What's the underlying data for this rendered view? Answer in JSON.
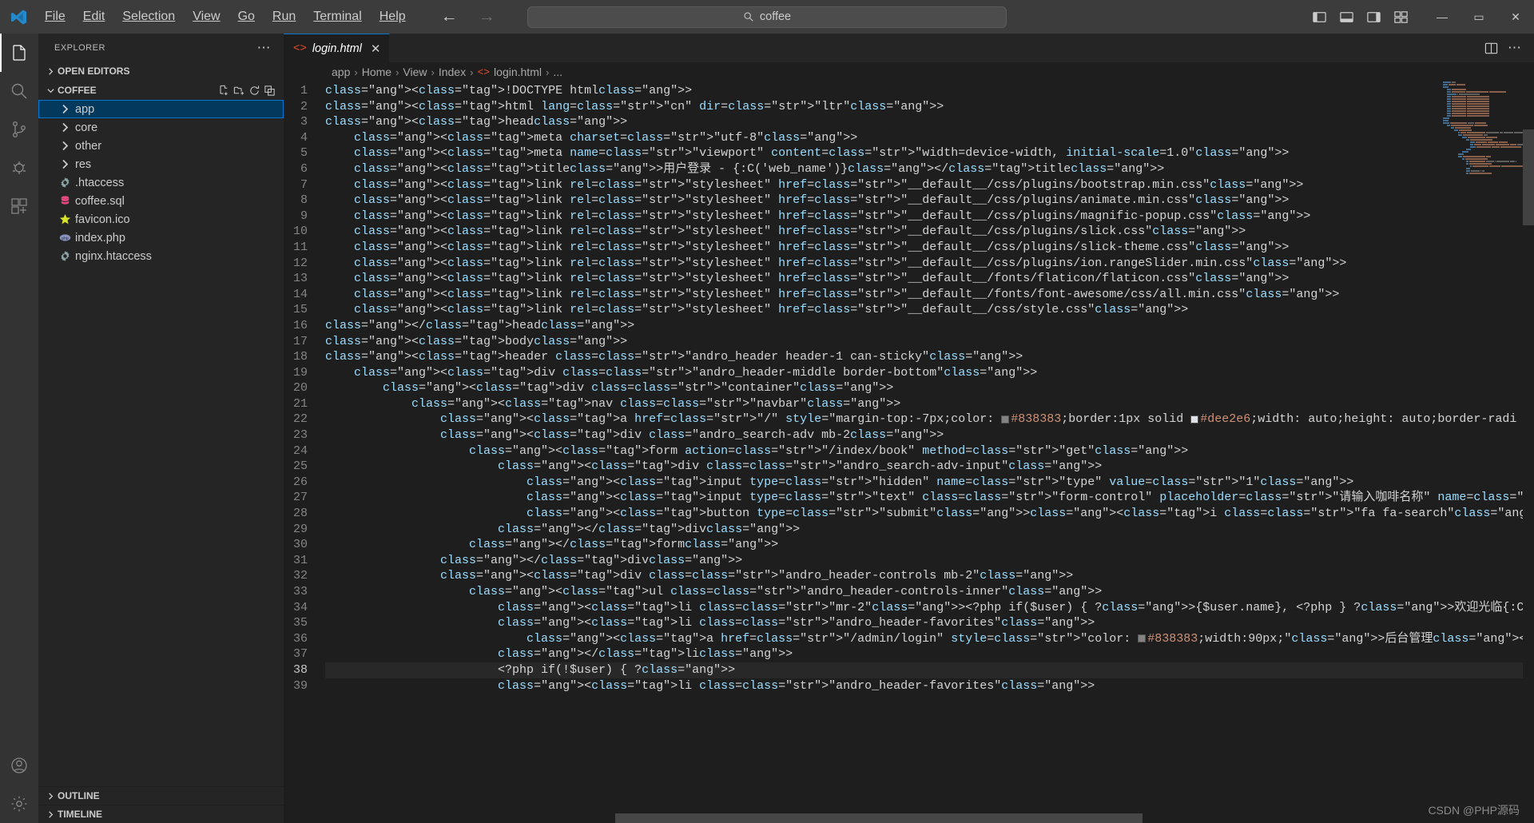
{
  "titlebar": {
    "logo_icon": "vscode-logo",
    "menus": [
      "File",
      "Edit",
      "Selection",
      "View",
      "Go",
      "Run",
      "Terminal",
      "Help"
    ],
    "back_icon": "arrow-left-icon",
    "forward_icon": "arrow-right-icon",
    "search": {
      "value": "coffee",
      "icon": "search-icon"
    },
    "layout_icons": [
      "panel-left-icon",
      "panel-bottom-icon",
      "panel-right-icon",
      "layout-grid-icon"
    ],
    "window_controls": {
      "minimize": "—",
      "maximize": "▭",
      "close": "✕"
    }
  },
  "activitybar": {
    "items": [
      {
        "name": "explorer",
        "icon": "files-icon",
        "active": true
      },
      {
        "name": "search",
        "icon": "search-icon",
        "active": false
      },
      {
        "name": "source-control",
        "icon": "source-control-icon",
        "active": false
      },
      {
        "name": "run-and-debug",
        "icon": "debug-icon",
        "active": false
      },
      {
        "name": "extensions",
        "icon": "extensions-icon",
        "active": false
      }
    ],
    "bottom": [
      {
        "name": "accounts",
        "icon": "account-icon"
      },
      {
        "name": "manage",
        "icon": "gear-icon"
      }
    ]
  },
  "sidebar": {
    "title": "EXPLORER",
    "more_actions": "⋯",
    "open_editors": {
      "label": "OPEN EDITORS",
      "expanded": false
    },
    "workspace": {
      "label": "COFFEE",
      "expanded": true,
      "actions": [
        "new-file-icon",
        "new-folder-icon",
        "refresh-icon",
        "collapse-all-icon"
      ]
    },
    "tree": [
      {
        "label": "app",
        "type": "folder",
        "selected": true,
        "icon": "chevron-right-icon"
      },
      {
        "label": "core",
        "type": "folder",
        "selected": false,
        "icon": "chevron-right-icon"
      },
      {
        "label": "other",
        "type": "folder",
        "selected": false,
        "icon": "chevron-right-icon"
      },
      {
        "label": "res",
        "type": "folder",
        "selected": false,
        "icon": "chevron-right-icon"
      },
      {
        "label": ".htaccess",
        "type": "file",
        "icon": "gear-file-icon"
      },
      {
        "label": "coffee.sql",
        "type": "file",
        "icon": "database-icon"
      },
      {
        "label": "favicon.ico",
        "type": "file",
        "icon": "star-icon"
      },
      {
        "label": "index.php",
        "type": "file",
        "icon": "php-icon"
      },
      {
        "label": "nginx.htaccess",
        "type": "file",
        "icon": "gear-file-icon"
      }
    ],
    "outline": "OUTLINE",
    "timeline": "TIMELINE"
  },
  "editor": {
    "tab": {
      "label": "login.html",
      "icon": "html-icon",
      "close": "✕",
      "dirty": false
    },
    "tabs_overflow": "⋯",
    "tab_actions": [
      "split-editor-icon",
      "more-actions-icon"
    ],
    "breadcrumb": [
      "app",
      "Home",
      "View",
      "Index",
      "login.html",
      "..."
    ],
    "breadcrumb_file_icon": "html-icon",
    "watermark": "CSDN @PHP源码",
    "colors": {
      "tag": "#569cd6",
      "attribute": "#9cdcfe",
      "string": "#ce9178",
      "punctuation": "#808080",
      "background": "#1e1e1e",
      "accent": "#0078d4",
      "selection": "#264f78",
      "swatch1": "#838383",
      "swatch2": "#dee2e6"
    },
    "lines": [
      {
        "n": 1,
        "text": "<!DOCTYPE html>"
      },
      {
        "n": 2,
        "text": "<html lang=\"cn\" dir=\"ltr\">"
      },
      {
        "n": 3,
        "text": "<head>"
      },
      {
        "n": 4,
        "text": "    <meta charset=\"utf-8\">"
      },
      {
        "n": 5,
        "text": "    <meta name=\"viewport\" content=\"width=device-width, initial-scale=1.0\">"
      },
      {
        "n": 6,
        "text": "    <title>用户登录 - {:C('web_name')}</title>"
      },
      {
        "n": 7,
        "text": "    <link rel=\"stylesheet\" href=\"__default__/css/plugins/bootstrap.min.css\">"
      },
      {
        "n": 8,
        "text": "    <link rel=\"stylesheet\" href=\"__default__/css/plugins/animate.min.css\">"
      },
      {
        "n": 9,
        "text": "    <link rel=\"stylesheet\" href=\"__default__/css/plugins/magnific-popup.css\">"
      },
      {
        "n": 10,
        "text": "    <link rel=\"stylesheet\" href=\"__default__/css/plugins/slick.css\">"
      },
      {
        "n": 11,
        "text": "    <link rel=\"stylesheet\" href=\"__default__/css/plugins/slick-theme.css\">"
      },
      {
        "n": 12,
        "text": "    <link rel=\"stylesheet\" href=\"__default__/css/plugins/ion.rangeSlider.min.css\">"
      },
      {
        "n": 13,
        "text": "    <link rel=\"stylesheet\" href=\"__default__/fonts/flaticon/flaticon.css\">"
      },
      {
        "n": 14,
        "text": "    <link rel=\"stylesheet\" href=\"__default__/fonts/font-awesome/css/all.min.css\">"
      },
      {
        "n": 15,
        "text": "    <link rel=\"stylesheet\" href=\"__default__/css/style.css\">"
      },
      {
        "n": 16,
        "text": "</head>"
      },
      {
        "n": 17,
        "text": "<body>"
      },
      {
        "n": 18,
        "text": "<header class=\"andro_header header-1 can-sticky\">"
      },
      {
        "n": 19,
        "text": "    <div class=\"andro_header-middle border-bottom\">"
      },
      {
        "n": 20,
        "text": "        <div class=\"container\">"
      },
      {
        "n": 21,
        "text": "            <nav class=\"navbar\">"
      },
      {
        "n": 22,
        "text": "                <a href=\"/\" style=\"margin-top:-7px;color: #838383;border:1px solid #dee2e6;width: auto;height: auto;border-radi"
      },
      {
        "n": 23,
        "text": "                <div class=\"andro_search-adv mb-2>"
      },
      {
        "n": 24,
        "text": "                    <form action=\"/index/book\" method=\"get\">"
      },
      {
        "n": 25,
        "text": "                        <div class=\"andro_search-adv-input\">"
      },
      {
        "n": 26,
        "text": "                            <input type=\"hidden\" name=\"type\" value=\"1\">"
      },
      {
        "n": 27,
        "text": "                            <input type=\"text\" class=\"form-control\" placeholder=\"请输入咖啡名称\" name=\"key\" required>"
      },
      {
        "n": 28,
        "text": "                            <button type=\"submit\"><i class=\"fa fa-search\"></i></button>"
      },
      {
        "n": 29,
        "text": "                        </div>"
      },
      {
        "n": 30,
        "text": "                    </form>"
      },
      {
        "n": 31,
        "text": "                </div>"
      },
      {
        "n": 32,
        "text": "                <div class=\"andro_header-controls mb-2\">"
      },
      {
        "n": 33,
        "text": "                    <ul class=\"andro_header-controls-inner\">"
      },
      {
        "n": 34,
        "text": "                        <li class=\"mr-2\"><?php if($user) { ?>{$user.name}, <?php } ?>欢迎光临{:C('web_name')}</li>"
      },
      {
        "n": 35,
        "text": "                        <li class=\"andro_header-favorites\">"
      },
      {
        "n": 36,
        "text": "                            <a href=\"/admin/login\" style=\"color: #838383;width:90px;\">后台管理</a>"
      },
      {
        "n": 37,
        "text": "                        </li>"
      },
      {
        "n": 38,
        "text": "                        <?php if(!$user) { ?>"
      },
      {
        "n": 39,
        "text": "                        <li class=\"andro_header-favorites\">"
      }
    ]
  }
}
